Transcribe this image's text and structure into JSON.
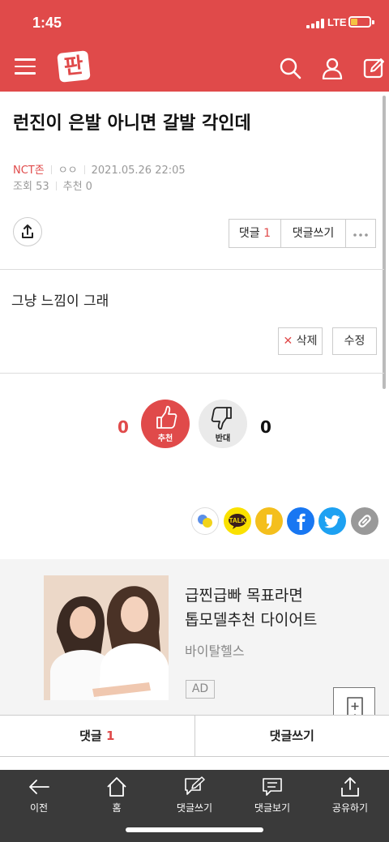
{
  "status": {
    "time": "1:45",
    "network": "LTE"
  },
  "colors": {
    "brand": "#e04a4a",
    "kakao": "#fae100",
    "facebook": "#1877f2",
    "twitter": "#1da1f2"
  },
  "header": {
    "logo_text": "판"
  },
  "post": {
    "title": "런진이 은발 아니면 갈발 각인데",
    "category": "NCT존",
    "author": "ㅇㅇ",
    "date": "2021.05.26 22:05",
    "views_label": "조회",
    "views": "53",
    "recommend_label": "추천",
    "recommend": "0",
    "body": "그냥 느낌이 그래"
  },
  "actions": {
    "comments_label": "댓글",
    "comments_count": "1",
    "write_comment": "댓글쓰기",
    "delete": "삭제",
    "edit": "수정"
  },
  "votes": {
    "up_count": "0",
    "up_label": "추천",
    "down_count": "0",
    "down_label": "반대"
  },
  "share_icons": [
    "share-icon-multi",
    "kakaotalk-icon",
    "kakaostory-icon",
    "facebook-icon",
    "twitter-icon",
    "link-icon"
  ],
  "kakao_talk_text": "TALK",
  "ad": {
    "title_line1": "급찐급빠 목표라면",
    "title_line2": "톱모델추천 다이어트",
    "advertiser": "바이탈헬스",
    "badge": "AD"
  },
  "comment_bar": {
    "comments_label": "댓글",
    "comments_count": "1",
    "write_label": "댓글쓰기"
  },
  "bottom_nav": [
    {
      "label": "이전",
      "icon": "back-arrow-icon"
    },
    {
      "label": "홈",
      "icon": "home-icon"
    },
    {
      "label": "댓글쓰기",
      "icon": "write-comment-icon"
    },
    {
      "label": "댓글보기",
      "icon": "view-comments-icon"
    },
    {
      "label": "공유하기",
      "icon": "share-icon"
    }
  ]
}
